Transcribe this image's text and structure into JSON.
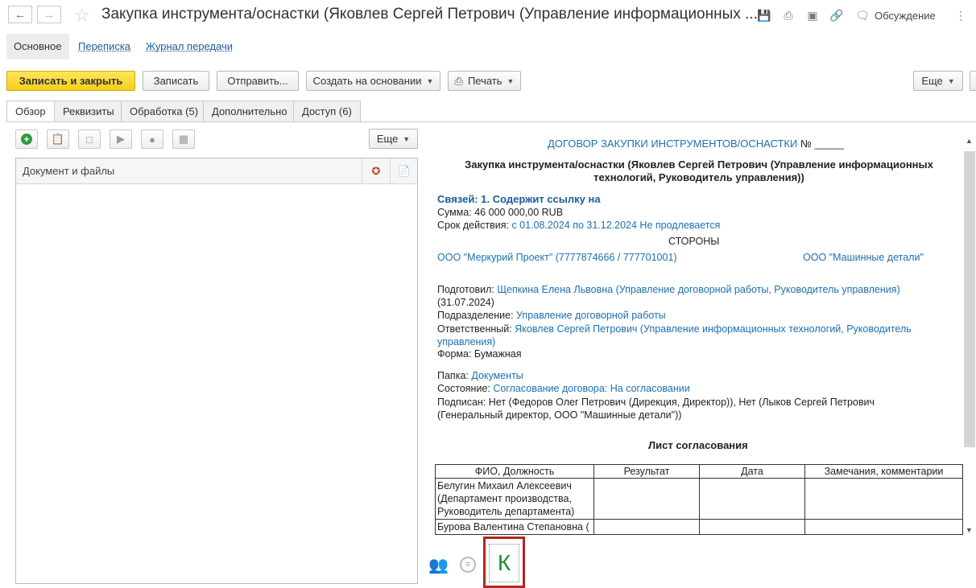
{
  "window": {
    "title": "Закупка инструмента/оснастки (Яковлев Сергей Петрович (Управление информационных ...",
    "discussion_label": "Обсуждение"
  },
  "section_tabs": {
    "main": "Основное",
    "correspondence": "Переписка",
    "transfer_log": "Журнал передачи"
  },
  "toolbar": {
    "save_close": "Записать и закрыть",
    "save": "Записать",
    "send": "Отправить...",
    "create_based": "Создать на основании",
    "print": "Печать",
    "more": "Еще"
  },
  "tabs": [
    "Обзор",
    "Реквизиты",
    "Обработка (5)",
    "Дополнительно",
    "Доступ (6)"
  ],
  "files": {
    "more": "Еще",
    "column_header": "Документ и файлы"
  },
  "document": {
    "heading": "ДОГОВОР ЗАКУПКИ ИНСТРУМЕНТОВ/ОСНАСТКИ",
    "number_suffix": "№ _____",
    "subject": "Закупка инструмента/оснастки (Яковлев Сергей Петрович (Управление информационных технологий, Руководитель управления))",
    "links": "Связей: 1. Содержит ссылку на",
    "sum_label": "Сумма:",
    "sum_value": "46 000 000,00 RUB",
    "term_label": "Срок действия:",
    "term_value": "с 01.08.2024 по 31.12.2024 Не продлевается",
    "parties_heading": "СТОРОНЫ",
    "party1": "ООО \"Меркурий Проект\" (7777874666 / 777701001)",
    "party2": "ООО \"Машинные детали\"",
    "prepared_label": "Подготовил:",
    "prepared_value": "Щепкина Елена Львовна (Управление договорной работы, Руководитель управления)",
    "prepared_date": "(31.07.2024)",
    "department_label": "Подразделение:",
    "department_value": "Управление договорной работы",
    "responsible_label": "Ответственный:",
    "responsible_value": "Яковлев Сергей Петрович (Управление информационных технологий, Руководитель управления)",
    "form_label": "Форма:",
    "form_value": "Бумажная",
    "folder_label": "Папка:",
    "folder_value": "Документы",
    "state_label": "Состояние:",
    "state_value": "Согласование договора: На согласовании",
    "signed_label": "Подписан:",
    "signed_value": "Нет (Федоров Олег Петрович (Дирекция, Директор)), Нет (Лыков Сергей Петрович (Генеральный директор, ООО \"Машинные детали\"))",
    "approval_heading": "Лист согласования",
    "table_headers": [
      "ФИО, Должность",
      "Результат",
      "Дата",
      "Замечания, комментарии"
    ],
    "rows": [
      {
        "person": "Белугин Михаил Алексеевич (Департамент производства, Руководитель департамента)"
      },
      {
        "person": "Бурова Валентина Степановна ("
      }
    ]
  },
  "bottom": {
    "k_label": "К"
  }
}
